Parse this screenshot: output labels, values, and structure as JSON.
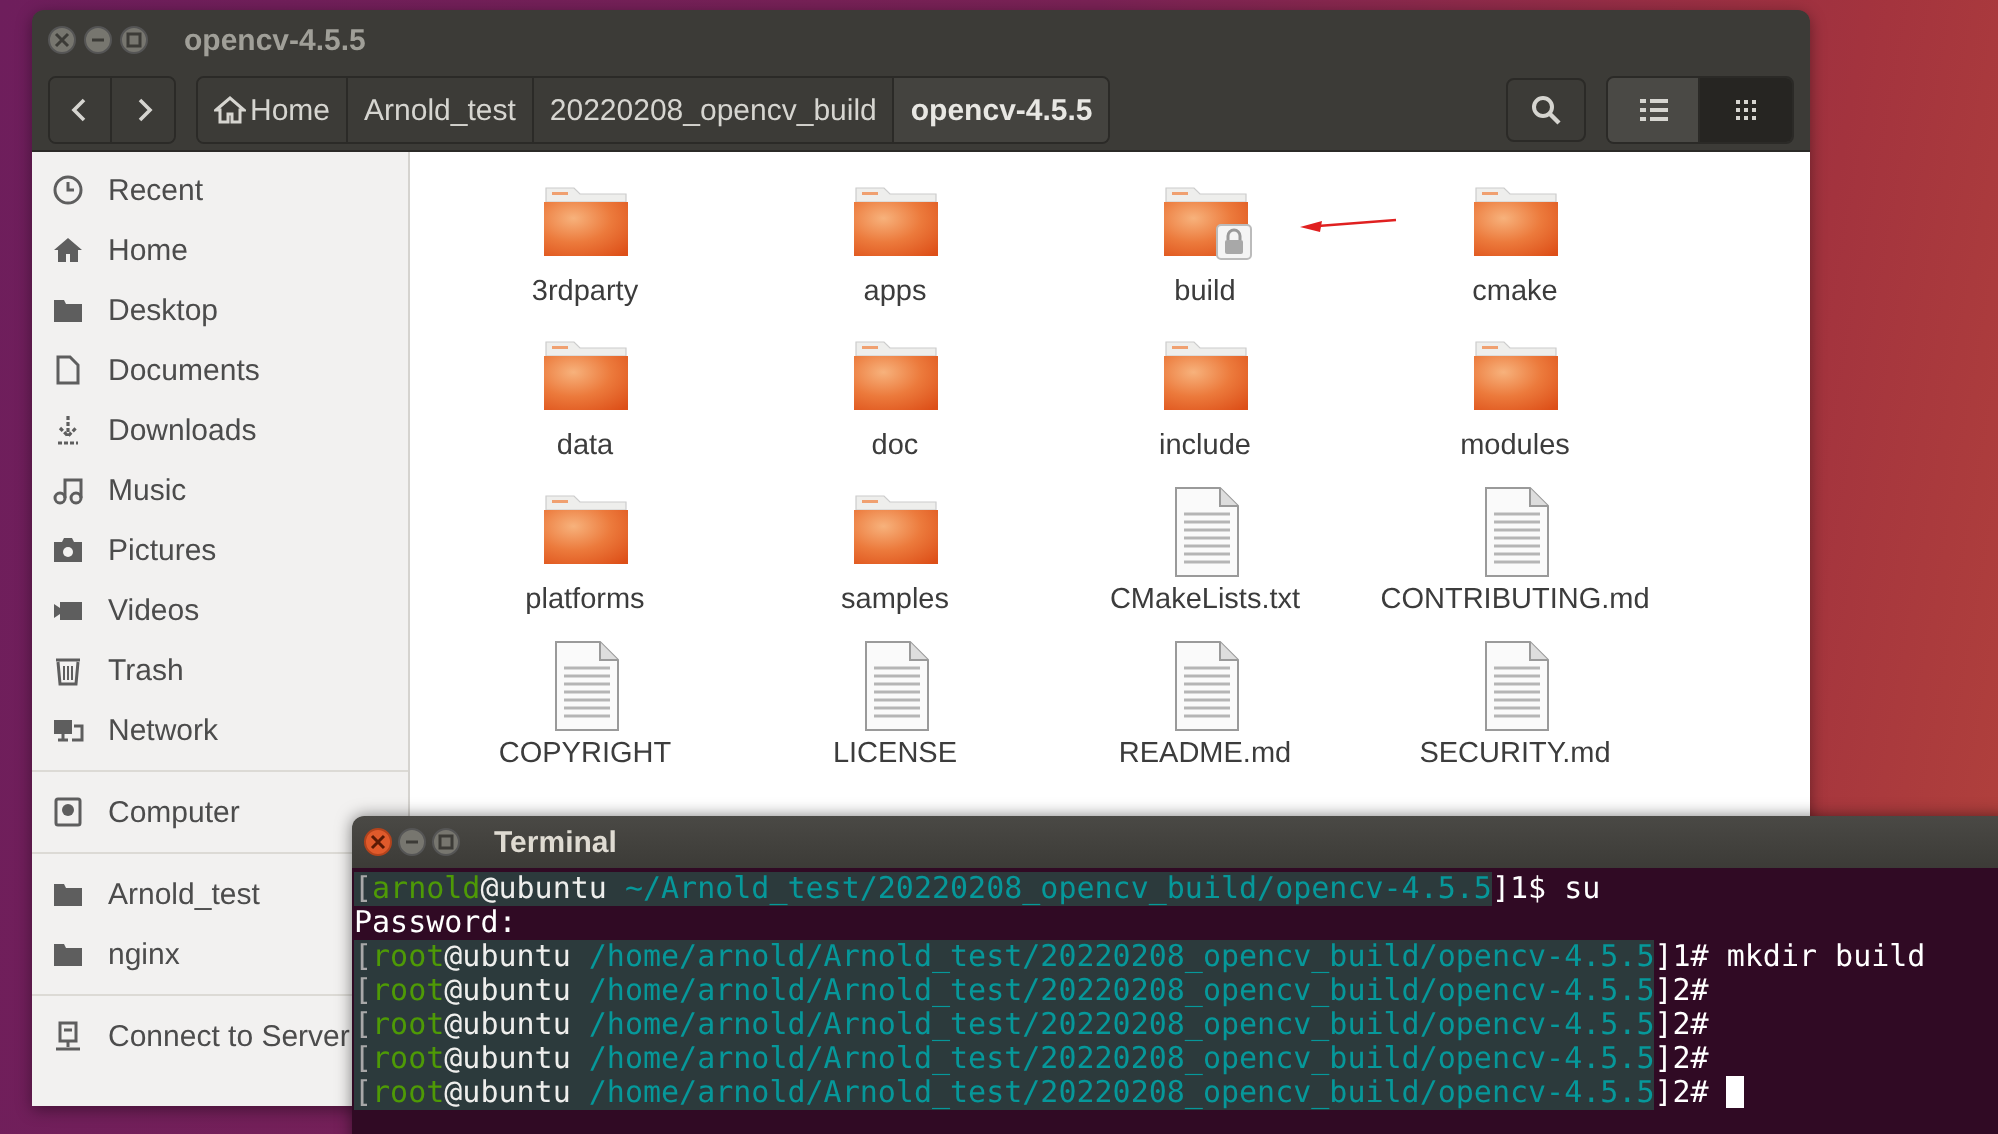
{
  "file_window": {
    "title": "opencv-4.5.5",
    "breadcrumbs": [
      {
        "label": "Home",
        "kind": "home",
        "selected": false
      },
      {
        "label": "Arnold_test",
        "kind": "folder",
        "selected": false
      },
      {
        "label": "20220208_opencv_build",
        "kind": "folder",
        "selected": false
      },
      {
        "label": "opencv-4.5.5",
        "kind": "folder",
        "selected": true
      }
    ],
    "view_buttons": [
      {
        "kind": "list",
        "selected": false
      },
      {
        "kind": "grid",
        "selected": true
      }
    ],
    "sidebar": {
      "sections": [
        {
          "items": [
            {
              "label": "Recent",
              "kind": "recent"
            },
            {
              "label": "Home",
              "kind": "home"
            },
            {
              "label": "Desktop",
              "kind": "folder"
            },
            {
              "label": "Documents",
              "kind": "document"
            },
            {
              "label": "Downloads",
              "kind": "download"
            },
            {
              "label": "Music",
              "kind": "music"
            },
            {
              "label": "Pictures",
              "kind": "camera"
            },
            {
              "label": "Videos",
              "kind": "video"
            },
            {
              "label": "Trash",
              "kind": "trash"
            },
            {
              "label": "Network",
              "kind": "network"
            }
          ]
        },
        {
          "items": [
            {
              "label": "Computer",
              "kind": "drive"
            }
          ]
        },
        {
          "items": [
            {
              "label": "Arnold_test",
              "kind": "folder"
            },
            {
              "label": "nginx",
              "kind": "folder"
            }
          ]
        },
        {
          "items": [
            {
              "label": "Connect to Server",
              "kind": "server"
            }
          ]
        }
      ]
    },
    "files": [
      {
        "name": "3rdparty",
        "kind": "folder",
        "locked": false
      },
      {
        "name": "apps",
        "kind": "folder",
        "locked": false
      },
      {
        "name": "build",
        "kind": "folder",
        "locked": true
      },
      {
        "name": "cmake",
        "kind": "folder",
        "locked": false
      },
      {
        "name": "data",
        "kind": "folder",
        "locked": false
      },
      {
        "name": "doc",
        "kind": "folder",
        "locked": false
      },
      {
        "name": "include",
        "kind": "folder",
        "locked": false
      },
      {
        "name": "modules",
        "kind": "folder",
        "locked": false
      },
      {
        "name": "platforms",
        "kind": "folder",
        "locked": false
      },
      {
        "name": "samples",
        "kind": "folder",
        "locked": false
      },
      {
        "name": "CMakeLists.txt",
        "kind": "text",
        "locked": false
      },
      {
        "name": "CONTRIBUTING.md",
        "kind": "text",
        "locked": false
      },
      {
        "name": "COPYRIGHT",
        "kind": "text",
        "locked": false
      },
      {
        "name": "LICENSE",
        "kind": "text",
        "locked": false
      },
      {
        "name": "README.md",
        "kind": "text",
        "locked": false
      },
      {
        "name": "SECURITY.md",
        "kind": "text",
        "locked": false
      }
    ]
  },
  "terminal": {
    "title": "Terminal",
    "lines": [
      {
        "cursor": false,
        "segments": [
          {
            "text": "[",
            "kind": "bracket",
            "highlighted": true
          },
          {
            "text": "arnold",
            "kind": "user",
            "highlighted": true
          },
          {
            "text": "@ubuntu ",
            "kind": "host",
            "highlighted": true
          },
          {
            "text": "~/Arnold_test/20220208_opencv_build/opencv-4.5.5",
            "kind": "path",
            "highlighted": true
          },
          {
            "text": "]1$ su",
            "kind": "text",
            "highlighted": false
          }
        ]
      },
      {
        "cursor": false,
        "segments": [
          {
            "text": "Password:",
            "kind": "text",
            "highlighted": false
          }
        ]
      },
      {
        "cursor": false,
        "segments": [
          {
            "text": "[",
            "kind": "bracket",
            "highlighted": true
          },
          {
            "text": "root",
            "kind": "user",
            "highlighted": true
          },
          {
            "text": "@ubuntu ",
            "kind": "host",
            "highlighted": true
          },
          {
            "text": "/home/arnold/Arnold_test/20220208_opencv_build/opencv-4.5.5",
            "kind": "path",
            "highlighted": true
          },
          {
            "text": "]1# mkdir build",
            "kind": "text",
            "highlighted": false
          }
        ]
      },
      {
        "cursor": false,
        "segments": [
          {
            "text": "[",
            "kind": "bracket",
            "highlighted": true
          },
          {
            "text": "root",
            "kind": "user",
            "highlighted": true
          },
          {
            "text": "@ubuntu ",
            "kind": "host",
            "highlighted": true
          },
          {
            "text": "/home/arnold/Arnold_test/20220208_opencv_build/opencv-4.5.5",
            "kind": "path",
            "highlighted": true
          },
          {
            "text": "]2#",
            "kind": "text",
            "highlighted": false
          }
        ]
      },
      {
        "cursor": false,
        "segments": [
          {
            "text": "[",
            "kind": "bracket",
            "highlighted": true
          },
          {
            "text": "root",
            "kind": "user",
            "highlighted": true
          },
          {
            "text": "@ubuntu ",
            "kind": "host",
            "highlighted": true
          },
          {
            "text": "/home/arnold/Arnold_test/20220208_opencv_build/opencv-4.5.5",
            "kind": "path",
            "highlighted": true
          },
          {
            "text": "]2#",
            "kind": "text",
            "highlighted": false
          }
        ]
      },
      {
        "cursor": false,
        "segments": [
          {
            "text": "[",
            "kind": "bracket",
            "highlighted": true
          },
          {
            "text": "root",
            "kind": "user",
            "highlighted": true
          },
          {
            "text": "@ubuntu ",
            "kind": "host",
            "highlighted": true
          },
          {
            "text": "/home/arnold/Arnold_test/20220208_opencv_build/opencv-4.5.5",
            "kind": "path",
            "highlighted": true
          },
          {
            "text": "]2#",
            "kind": "text",
            "highlighted": false
          }
        ]
      },
      {
        "cursor": true,
        "segments": [
          {
            "text": "[",
            "kind": "bracket",
            "highlighted": true
          },
          {
            "text": "root",
            "kind": "user",
            "highlighted": true
          },
          {
            "text": "@ubuntu ",
            "kind": "host",
            "highlighted": true
          },
          {
            "text": "/home/arnold/Arnold_test/20220208_opencv_build/opencv-4.5.5",
            "kind": "path",
            "highlighted": true
          },
          {
            "text": "]2# ",
            "kind": "text",
            "highlighted": false
          }
        ]
      }
    ]
  }
}
